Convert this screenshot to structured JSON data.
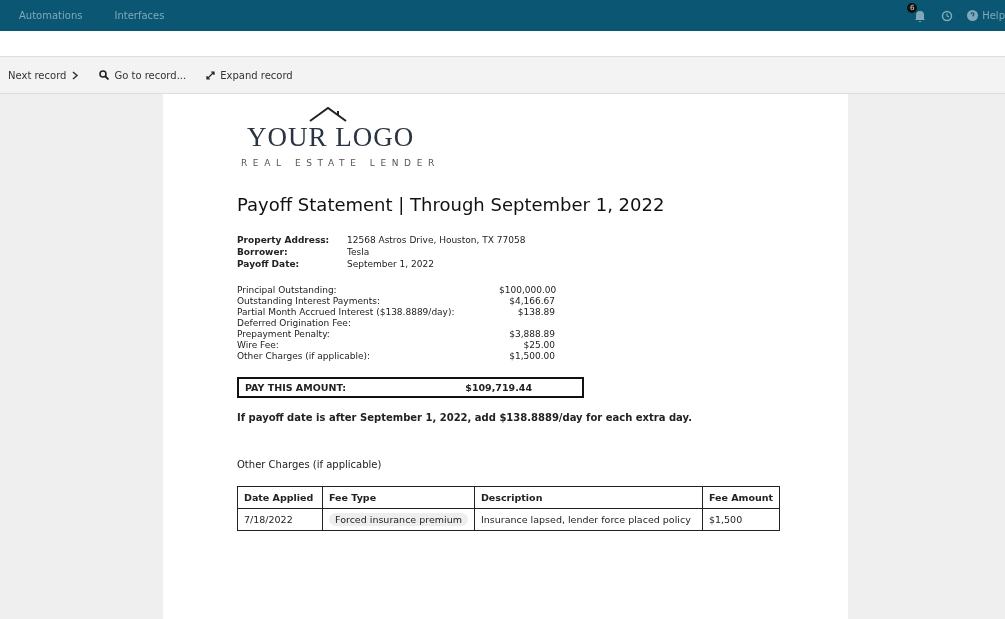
{
  "nav": {
    "items": [
      "Automations",
      "Interfaces"
    ],
    "notification_count": "6",
    "help": "Help"
  },
  "toolbar": {
    "next": "Next record",
    "goto": "Go to record...",
    "expand": "Expand record"
  },
  "logo": {
    "title": "YOUR LOGO",
    "subtitle": "REAL ESTATE LENDER"
  },
  "heading": "Payoff Statement | Through September 1, 2022",
  "info": [
    {
      "label": "Property Address:",
      "value": "12568 Astros Drive, Houston, TX 77058"
    },
    {
      "label": "Borrower:",
      "value": "Tesla"
    },
    {
      "label": "Payoff Date:",
      "value": "September 1, 2022"
    }
  ],
  "charges": [
    {
      "label": "Principal Outstanding:",
      "amount": "$100,000.00"
    },
    {
      "label": "Outstanding Interest Payments:",
      "amount": "$4,166.67"
    },
    {
      "label": "Partial Month Accrued Interest ($138.8889/day):",
      "amount": "$138.89"
    },
    {
      "label": "Deferred Origination Fee:"
    },
    {
      "label": "Prepayment Penalty:",
      "amount": "$3,888.89"
    },
    {
      "label": "Wire Fee:",
      "amount": "$25.00"
    },
    {
      "label": "Other Charges (if applicable):",
      "amount": "$1,500.00"
    }
  ],
  "total": {
    "label": "PAY THIS AMOUNT:",
    "amount": "$109,719.44"
  },
  "note": "If payoff date is after September 1, 2022, add $138.8889/day for each extra day.",
  "other_title": "Other Charges (if applicable)",
  "table": {
    "columns": [
      "Date Applied",
      "Fee Type",
      "Description",
      "Fee Amount"
    ],
    "rows": [
      [
        "7/18/2022",
        "Forced insurance premium",
        "Insurance lapsed, lender force placed policy",
        "$1,500"
      ]
    ]
  }
}
